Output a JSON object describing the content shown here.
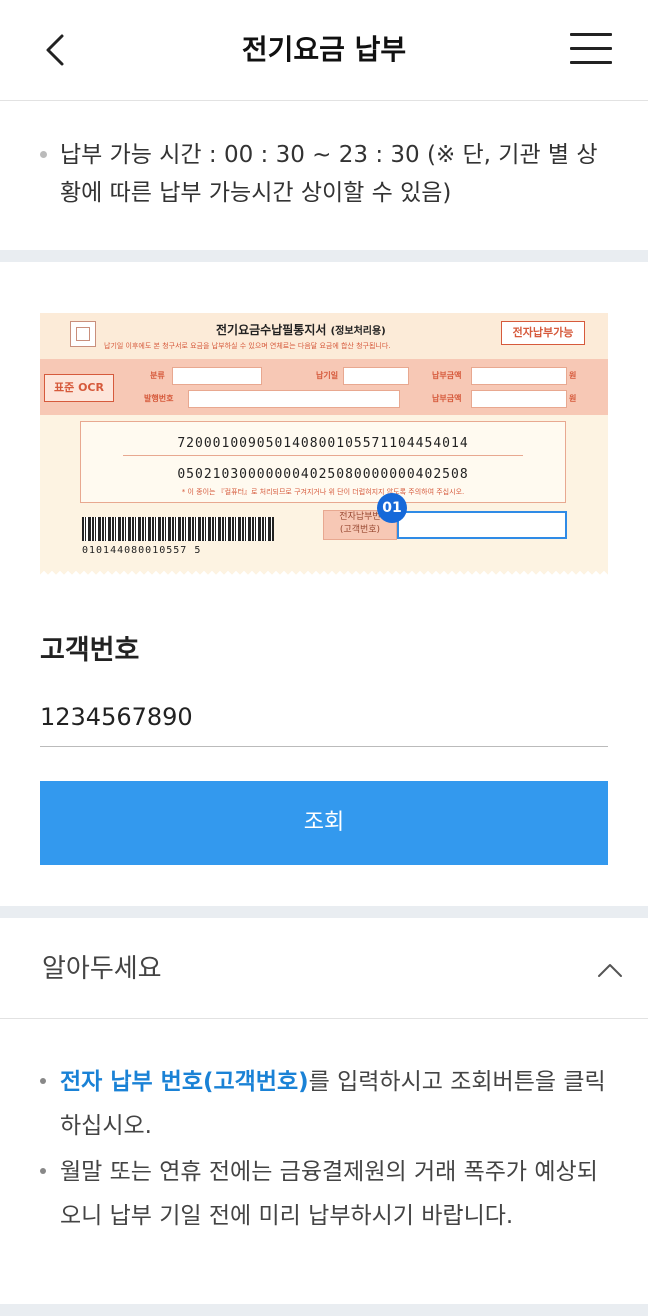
{
  "header": {
    "title": "전기요금 납부"
  },
  "notice": {
    "text": "납부 가능 시간 : 00 : 30 ~ 23 : 30 (※ 단, 기관 별 상황에 따른 납부 가능시간 상이할 수 있음)"
  },
  "bill": {
    "title": "전기요금수납필통지서",
    "title_sub": "(정보처리용)",
    "subtitle": "납기일 이후에도 본 청구서로 요금을 납부하실 수 있으며 연체료는 다음달 요금에 합산 청구됩니다.",
    "badge_right": "전자납부가능",
    "ocr_label": "표준 OCR",
    "field_category": "분류",
    "field_due": "납기일",
    "field_amount1": "납부금액",
    "field_amount2": "납부금액",
    "field_issue": "발행번호",
    "won1": "원",
    "won2": "원",
    "number_line1": "720001009050140800105571104454014",
    "number_line2": "050210300000004025080000000402508",
    "notice_line": "* 이 종이는 『컬퓨터』로 처리되므로 구겨지거나 위 단이 더럽혀지지 않도록 주의하여 주십시오.",
    "barcode_number": "010144080010557 5",
    "epay_label_1": "전자납부번",
    "epay_label_2": "(고객번호)",
    "marker": "01"
  },
  "form": {
    "label": "고객번호",
    "value": "1234567890",
    "button": "조회"
  },
  "accordion": {
    "title": "알아두세요",
    "items": [
      {
        "highlight": "전자 납부 번호(고객번호)",
        "text": "를 입력하시고 조회버튼을 클릭하십시오."
      },
      {
        "highlight": "",
        "text": "월말 또는 연휴 전에는 금융결제원의 거래 폭주가 예상되오니 납부 기일 전에 미리 납부하시기 바랍니다."
      }
    ]
  }
}
